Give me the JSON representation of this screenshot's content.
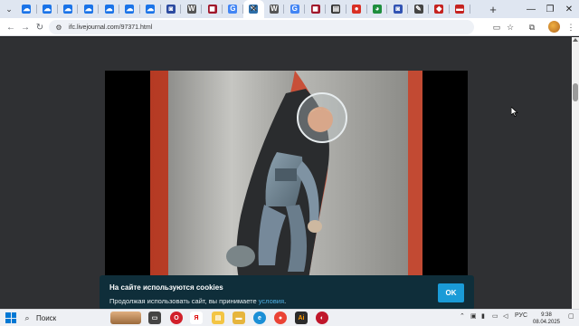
{
  "browser": {
    "tab_favicons": [
      {
        "icon": "blue-bird-icon",
        "color": "#1a73e8",
        "glyph": "☁"
      },
      {
        "icon": "blue-bird-icon",
        "color": "#1a73e8",
        "glyph": "☁"
      },
      {
        "icon": "blue-bird-icon",
        "color": "#1a73e8",
        "glyph": "☁"
      },
      {
        "icon": "blue-bird-icon",
        "color": "#1a73e8",
        "glyph": "☁"
      },
      {
        "icon": "blue-bird-icon",
        "color": "#1a73e8",
        "glyph": "☁"
      },
      {
        "icon": "blue-bird-icon",
        "color": "#1a73e8",
        "glyph": "☁"
      },
      {
        "icon": "blue-bird-icon",
        "color": "#1a73e8",
        "glyph": "☁"
      },
      {
        "icon": "pinned-site-icon",
        "color": "#2b4aa0",
        "glyph": "◙"
      },
      {
        "icon": "wikipedia-icon",
        "color": "#555555",
        "glyph": "W"
      },
      {
        "icon": "red-site-icon",
        "color": "#a0162a",
        "glyph": "◼"
      },
      {
        "icon": "google-icon",
        "color": "#4285f4",
        "glyph": "G"
      },
      {
        "icon": "livejournal-icon",
        "color": "#2d6ea8",
        "glyph": "✎"
      },
      {
        "icon": "wikipedia-icon",
        "color": "#555555",
        "glyph": "W"
      },
      {
        "icon": "google-icon",
        "color": "#4285f4",
        "glyph": "G"
      },
      {
        "icon": "red-site-icon",
        "color": "#a0162a",
        "glyph": "◼"
      },
      {
        "icon": "dark-site-icon",
        "color": "#333333",
        "glyph": "▤"
      },
      {
        "icon": "pin-icon",
        "color": "#d93025",
        "glyph": "●"
      },
      {
        "icon": "green-site-icon",
        "color": "#1e8e3e",
        "glyph": "◕"
      },
      {
        "icon": "blue-square-icon",
        "color": "#3153b3",
        "glyph": "◙"
      },
      {
        "icon": "pencil-site-icon",
        "color": "#444444",
        "glyph": "✎"
      },
      {
        "icon": "red-drop-icon",
        "color": "#c5221f",
        "glyph": "◆"
      },
      {
        "icon": "red-bar-icon",
        "color": "#c5221f",
        "glyph": "▬"
      }
    ],
    "close_glyph": "✕",
    "new_tab_glyph": "+",
    "url": "ifc.livejournal.com/97371.html"
  },
  "cookie_banner": {
    "title": "На сайте используются cookies",
    "text": "Продолжая использовать сайт, вы принимаете ",
    "link": "условия",
    "text_end": ".",
    "button": "OK",
    "background": "#0f2e3a",
    "button_color": "#1a9bd7"
  },
  "taskbar": {
    "search_label": "Поиск",
    "language": "РУС",
    "time": "9:38",
    "date": "08.04.2025"
  }
}
